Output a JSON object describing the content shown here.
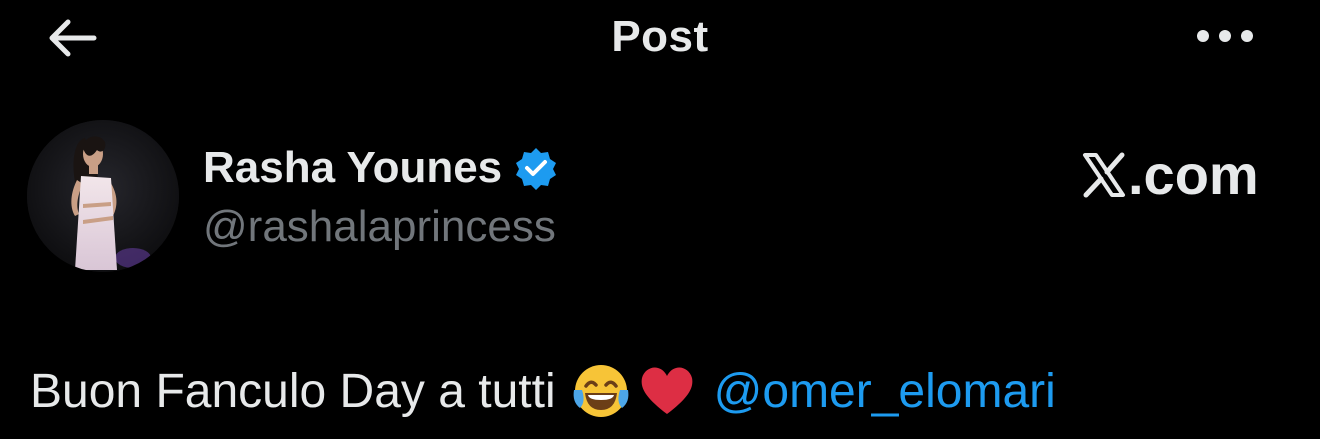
{
  "header": {
    "title": "Post",
    "back_icon": "arrow-left-icon",
    "more_icon": "more-horizontal-icon"
  },
  "author": {
    "name": "Rasha Younes",
    "handle": "@rashalaprincess",
    "verified": true
  },
  "watermark": {
    "text": ".com",
    "logo": "x-logo-icon"
  },
  "post": {
    "text": "Buon Fanculo Day a tutti",
    "emojis": [
      "tears-of-joy-emoji",
      "red-heart-emoji"
    ],
    "mention": "@omer_elomari"
  },
  "colors": {
    "background": "#000000",
    "text": "#e7e9ea",
    "secondary": "#71767b",
    "accent": "#1d9bf0"
  }
}
